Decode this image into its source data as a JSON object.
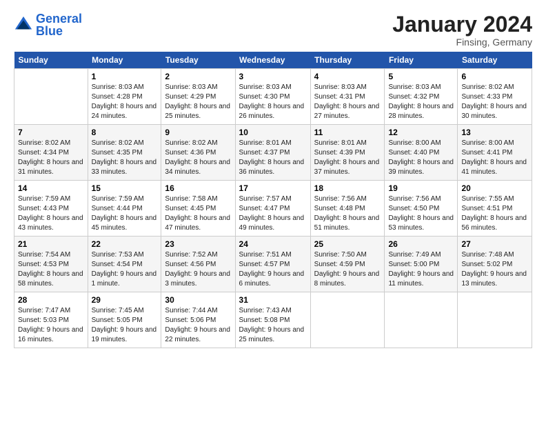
{
  "header": {
    "logo_general": "General",
    "logo_blue": "Blue",
    "month_title": "January 2024",
    "location": "Finsing, Germany"
  },
  "days_of_week": [
    "Sunday",
    "Monday",
    "Tuesday",
    "Wednesday",
    "Thursday",
    "Friday",
    "Saturday"
  ],
  "weeks": [
    [
      {
        "day": "",
        "sunrise": "",
        "sunset": "",
        "daylight": ""
      },
      {
        "day": "1",
        "sunrise": "Sunrise: 8:03 AM",
        "sunset": "Sunset: 4:28 PM",
        "daylight": "Daylight: 8 hours and 24 minutes."
      },
      {
        "day": "2",
        "sunrise": "Sunrise: 8:03 AM",
        "sunset": "Sunset: 4:29 PM",
        "daylight": "Daylight: 8 hours and 25 minutes."
      },
      {
        "day": "3",
        "sunrise": "Sunrise: 8:03 AM",
        "sunset": "Sunset: 4:30 PM",
        "daylight": "Daylight: 8 hours and 26 minutes."
      },
      {
        "day": "4",
        "sunrise": "Sunrise: 8:03 AM",
        "sunset": "Sunset: 4:31 PM",
        "daylight": "Daylight: 8 hours and 27 minutes."
      },
      {
        "day": "5",
        "sunrise": "Sunrise: 8:03 AM",
        "sunset": "Sunset: 4:32 PM",
        "daylight": "Daylight: 8 hours and 28 minutes."
      },
      {
        "day": "6",
        "sunrise": "Sunrise: 8:02 AM",
        "sunset": "Sunset: 4:33 PM",
        "daylight": "Daylight: 8 hours and 30 minutes."
      }
    ],
    [
      {
        "day": "7",
        "sunrise": "Sunrise: 8:02 AM",
        "sunset": "Sunset: 4:34 PM",
        "daylight": "Daylight: 8 hours and 31 minutes."
      },
      {
        "day": "8",
        "sunrise": "Sunrise: 8:02 AM",
        "sunset": "Sunset: 4:35 PM",
        "daylight": "Daylight: 8 hours and 33 minutes."
      },
      {
        "day": "9",
        "sunrise": "Sunrise: 8:02 AM",
        "sunset": "Sunset: 4:36 PM",
        "daylight": "Daylight: 8 hours and 34 minutes."
      },
      {
        "day": "10",
        "sunrise": "Sunrise: 8:01 AM",
        "sunset": "Sunset: 4:37 PM",
        "daylight": "Daylight: 8 hours and 36 minutes."
      },
      {
        "day": "11",
        "sunrise": "Sunrise: 8:01 AM",
        "sunset": "Sunset: 4:39 PM",
        "daylight": "Daylight: 8 hours and 37 minutes."
      },
      {
        "day": "12",
        "sunrise": "Sunrise: 8:00 AM",
        "sunset": "Sunset: 4:40 PM",
        "daylight": "Daylight: 8 hours and 39 minutes."
      },
      {
        "day": "13",
        "sunrise": "Sunrise: 8:00 AM",
        "sunset": "Sunset: 4:41 PM",
        "daylight": "Daylight: 8 hours and 41 minutes."
      }
    ],
    [
      {
        "day": "14",
        "sunrise": "Sunrise: 7:59 AM",
        "sunset": "Sunset: 4:43 PM",
        "daylight": "Daylight: 8 hours and 43 minutes."
      },
      {
        "day": "15",
        "sunrise": "Sunrise: 7:59 AM",
        "sunset": "Sunset: 4:44 PM",
        "daylight": "Daylight: 8 hours and 45 minutes."
      },
      {
        "day": "16",
        "sunrise": "Sunrise: 7:58 AM",
        "sunset": "Sunset: 4:45 PM",
        "daylight": "Daylight: 8 hours and 47 minutes."
      },
      {
        "day": "17",
        "sunrise": "Sunrise: 7:57 AM",
        "sunset": "Sunset: 4:47 PM",
        "daylight": "Daylight: 8 hours and 49 minutes."
      },
      {
        "day": "18",
        "sunrise": "Sunrise: 7:56 AM",
        "sunset": "Sunset: 4:48 PM",
        "daylight": "Daylight: 8 hours and 51 minutes."
      },
      {
        "day": "19",
        "sunrise": "Sunrise: 7:56 AM",
        "sunset": "Sunset: 4:50 PM",
        "daylight": "Daylight: 8 hours and 53 minutes."
      },
      {
        "day": "20",
        "sunrise": "Sunrise: 7:55 AM",
        "sunset": "Sunset: 4:51 PM",
        "daylight": "Daylight: 8 hours and 56 minutes."
      }
    ],
    [
      {
        "day": "21",
        "sunrise": "Sunrise: 7:54 AM",
        "sunset": "Sunset: 4:53 PM",
        "daylight": "Daylight: 8 hours and 58 minutes."
      },
      {
        "day": "22",
        "sunrise": "Sunrise: 7:53 AM",
        "sunset": "Sunset: 4:54 PM",
        "daylight": "Daylight: 9 hours and 1 minute."
      },
      {
        "day": "23",
        "sunrise": "Sunrise: 7:52 AM",
        "sunset": "Sunset: 4:56 PM",
        "daylight": "Daylight: 9 hours and 3 minutes."
      },
      {
        "day": "24",
        "sunrise": "Sunrise: 7:51 AM",
        "sunset": "Sunset: 4:57 PM",
        "daylight": "Daylight: 9 hours and 6 minutes."
      },
      {
        "day": "25",
        "sunrise": "Sunrise: 7:50 AM",
        "sunset": "Sunset: 4:59 PM",
        "daylight": "Daylight: 9 hours and 8 minutes."
      },
      {
        "day": "26",
        "sunrise": "Sunrise: 7:49 AM",
        "sunset": "Sunset: 5:00 PM",
        "daylight": "Daylight: 9 hours and 11 minutes."
      },
      {
        "day": "27",
        "sunrise": "Sunrise: 7:48 AM",
        "sunset": "Sunset: 5:02 PM",
        "daylight": "Daylight: 9 hours and 13 minutes."
      }
    ],
    [
      {
        "day": "28",
        "sunrise": "Sunrise: 7:47 AM",
        "sunset": "Sunset: 5:03 PM",
        "daylight": "Daylight: 9 hours and 16 minutes."
      },
      {
        "day": "29",
        "sunrise": "Sunrise: 7:45 AM",
        "sunset": "Sunset: 5:05 PM",
        "daylight": "Daylight: 9 hours and 19 minutes."
      },
      {
        "day": "30",
        "sunrise": "Sunrise: 7:44 AM",
        "sunset": "Sunset: 5:06 PM",
        "daylight": "Daylight: 9 hours and 22 minutes."
      },
      {
        "day": "31",
        "sunrise": "Sunrise: 7:43 AM",
        "sunset": "Sunset: 5:08 PM",
        "daylight": "Daylight: 9 hours and 25 minutes."
      },
      {
        "day": "",
        "sunrise": "",
        "sunset": "",
        "daylight": ""
      },
      {
        "day": "",
        "sunrise": "",
        "sunset": "",
        "daylight": ""
      },
      {
        "day": "",
        "sunrise": "",
        "sunset": "",
        "daylight": ""
      }
    ]
  ]
}
